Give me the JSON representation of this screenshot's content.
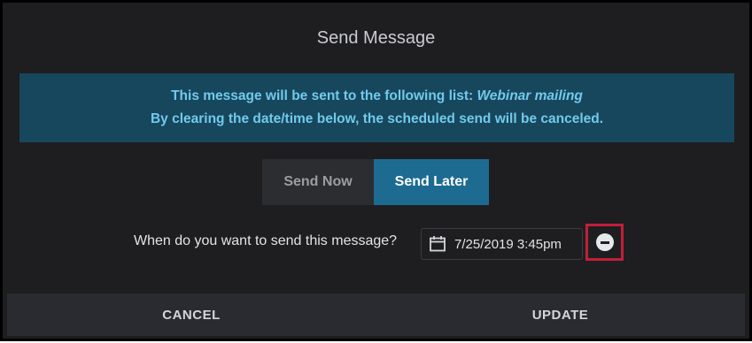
{
  "dialog": {
    "title": "Send Message"
  },
  "banner": {
    "line1_prefix": "This message will be sent to the following list: ",
    "list_name": "Webinar mailing",
    "line2": "By clearing the date/time below, the scheduled send will be canceled."
  },
  "send_mode": {
    "options": [
      "Send Now",
      "Send Later"
    ],
    "selected": "Send Later"
  },
  "schedule": {
    "question": "When do you want to send this message?",
    "datetime_value": "7/25/2019 3:45pm",
    "calendar_icon": "calendar-icon",
    "clear_icon": "minus-circle-icon",
    "highlight_color": "#c01f3a"
  },
  "footer": {
    "cancel_label": "CANCEL",
    "update_label": "UPDATE"
  },
  "colors": {
    "background": "#1e1e20",
    "banner_bg": "#17475c",
    "banner_text": "#72c9ec",
    "selected_segment": "#1d6b91",
    "unselected_segment": "#2c2d31",
    "footer_bg": "#2a2b30"
  }
}
